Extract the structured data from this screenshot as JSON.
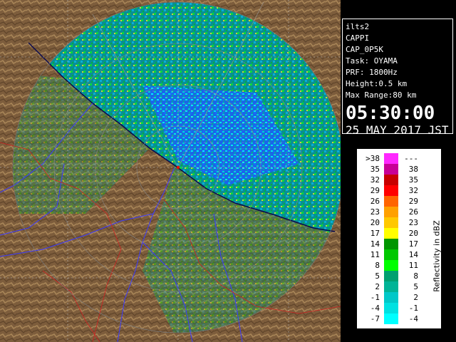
{
  "info": {
    "site": "ilts2",
    "product": "CAPPI",
    "product_code": "CAP_0P5K",
    "task": "Task: OYAMA",
    "prf": "PRF: 1800Hz",
    "height": "Height:0.5 km",
    "max_range": "Max Range:80 km",
    "time": "05:30:00",
    "date": "25 MAY 2017 JST"
  },
  "legend": {
    "title": "Reflectivity in dBZ",
    "rows": [
      {
        "lo": ">38",
        "hi": "---",
        "color": "#ff28ff"
      },
      {
        "lo": "35",
        "hi": "38",
        "color": "#c80096"
      },
      {
        "lo": "32",
        "hi": "35",
        "color": "#c80000"
      },
      {
        "lo": "29",
        "hi": "32",
        "color": "#ff0000"
      },
      {
        "lo": "26",
        "hi": "29",
        "color": "#ff6400"
      },
      {
        "lo": "23",
        "hi": "26",
        "color": "#ffa000"
      },
      {
        "lo": "20",
        "hi": "23",
        "color": "#ffc800"
      },
      {
        "lo": "17",
        "hi": "20",
        "color": "#ffff00"
      },
      {
        "lo": "14",
        "hi": "17",
        "color": "#009600"
      },
      {
        "lo": "11",
        "hi": "14",
        "color": "#00c800"
      },
      {
        "lo": "8",
        "hi": "11",
        "color": "#00ff00"
      },
      {
        "lo": "5",
        "hi": "8",
        "color": "#00a070"
      },
      {
        "lo": "2",
        "hi": "5",
        "color": "#00b496"
      },
      {
        "lo": "-1",
        "hi": "2",
        "color": "#00c8c8"
      },
      {
        "lo": "-4",
        "hi": "-1",
        "color": "#00e1e1"
      },
      {
        "lo": "-7",
        "hi": "-4",
        "color": "#00ffff"
      }
    ]
  },
  "map_colors": {
    "sea": "#1e5aff",
    "land": "#8a6a44",
    "coast": "#0a0a50",
    "rivers": "#3a3aff",
    "roads": "#d02020"
  }
}
